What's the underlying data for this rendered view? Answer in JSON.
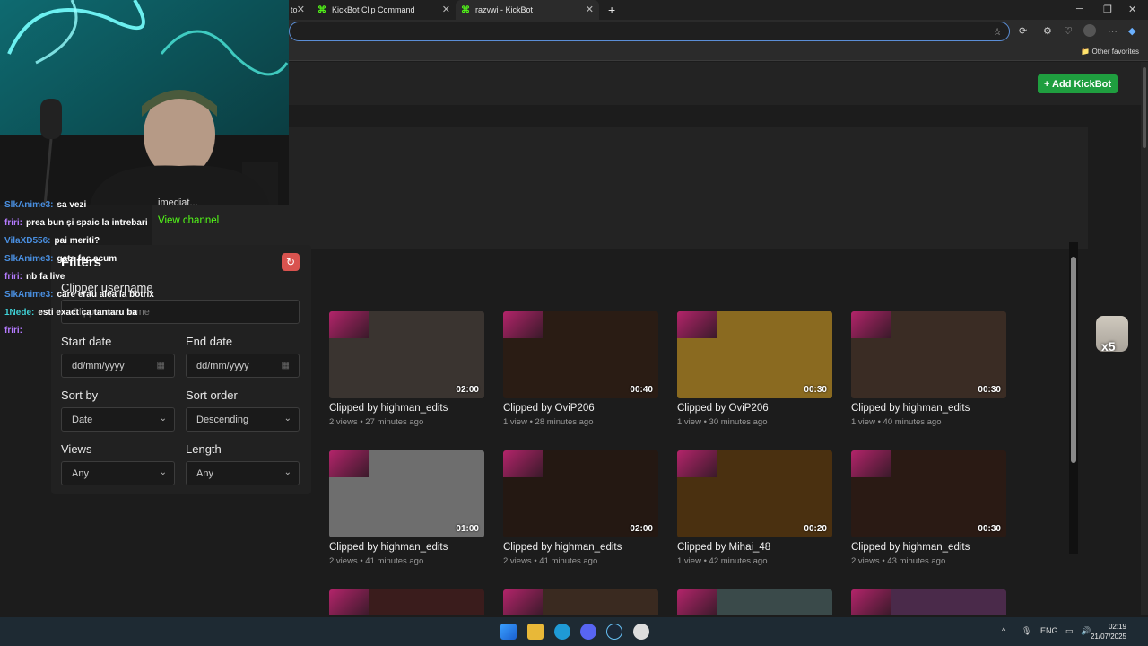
{
  "browser": {
    "tabs": [
      {
        "title": "KickBot Clip Command"
      },
      {
        "title": "razvwi - KickBot"
      }
    ],
    "new_tab": "+",
    "other_favorites": "Other favorites"
  },
  "header": {
    "add_button": "+ Add KickBot"
  },
  "webcam": {
    "subtitle": "imediat...",
    "view_channel": "View channel"
  },
  "chat": [
    {
      "user": "SlkAnime3:",
      "msg": "sa vezi",
      "color": "#4a90e2"
    },
    {
      "user": "friri:",
      "msg": "prea bun și spaic la intrebari",
      "color": "#b57bff"
    },
    {
      "user": "VilaXD556:",
      "msg": "pai meriti?",
      "color": "#4a90e2"
    },
    {
      "user": "SlkAnime3:",
      "msg": "gata fac acum",
      "color": "#4a90e2"
    },
    {
      "user": "friri:",
      "msg": "nb fa live",
      "color": "#b57bff"
    },
    {
      "user": "SlkAnime3:",
      "msg": "care erau alea la botrix",
      "color": "#4a90e2"
    },
    {
      "user": "1Nede:",
      "msg": "esti exact ca tantaru ba",
      "color": "#3fd1d6"
    },
    {
      "user": "friri:",
      "msg": "",
      "color": "#b57bff"
    }
  ],
  "filters": {
    "title": "Filters",
    "clipper_label": "Clipper username",
    "clipper_placeholder": "Clipper username",
    "start_label": "Start date",
    "start_value": "dd/mm/yyyy",
    "end_label": "End date",
    "end_value": "dd/mm/yyyy",
    "sortby_label": "Sort by",
    "sortby_value": "Date",
    "sortorder_label": "Sort order",
    "sortorder_value": "Descending",
    "views_label": "Views",
    "views_value": "Any",
    "length_label": "Length",
    "length_value": "Any"
  },
  "clips": [
    {
      "title": "Clipped by highman_edits",
      "meta": "2 views • 27 minutes ago",
      "duration": "02:00",
      "bg": "#3a3430"
    },
    {
      "title": "Clipped by OviP206",
      "meta": "1 view • 28 minutes ago",
      "duration": "00:40",
      "bg": "#2a1c14"
    },
    {
      "title": "Clipped by OviP206",
      "meta": "1 view • 30 minutes ago",
      "duration": "00:30",
      "bg": "#8a6a20"
    },
    {
      "title": "Clipped by highman_edits",
      "meta": "1 view • 40 minutes ago",
      "duration": "00:30",
      "bg": "#3a2c24"
    },
    {
      "title": "Clipped by highman_edits",
      "meta": "2 views • 41 minutes ago",
      "duration": "01:00",
      "bg": "#6e6e6e"
    },
    {
      "title": "Clipped by highman_edits",
      "meta": "2 views • 41 minutes ago",
      "duration": "02:00",
      "bg": "#241812"
    },
    {
      "title": "Clipped by Mihai_48",
      "meta": "1 view • 42 minutes ago",
      "duration": "00:20",
      "bg": "#4a3010"
    },
    {
      "title": "Clipped by highman_edits",
      "meta": "2 views • 43 minutes ago",
      "duration": "00:30",
      "bg": "#2a1a14"
    },
    {
      "bg": "#3a1c1c"
    },
    {
      "bg": "#3a2a20"
    },
    {
      "bg": "#3a4a4a"
    },
    {
      "bg": "#4a2a4a"
    }
  ],
  "side": {
    "badge": "x5"
  },
  "taskbar": {
    "lang": "ENG",
    "time": "02:19",
    "date": "21/07/2025"
  }
}
